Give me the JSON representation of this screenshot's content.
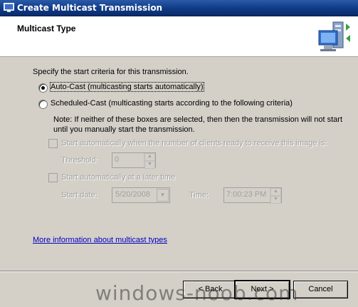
{
  "window": {
    "title": "Create Multicast Transmission"
  },
  "header": {
    "title": "Multicast Type",
    "icon": "server-computer-icon"
  },
  "intro": "Specify the start criteria for this transmission.",
  "options": {
    "auto_cast": {
      "label": "Auto-Cast (multicasting starts automatically)",
      "selected": true
    },
    "scheduled_cast": {
      "label": "Scheduled-Cast (multicasting starts according to the following criteria)",
      "selected": false
    }
  },
  "note": {
    "line1": "Note: If neither of these boxes are selected, then then the transmission will not start",
    "line2": "until you manually start the transmission."
  },
  "criteria": {
    "clients": {
      "label": "Start automatically when the number of clients ready to receive this image is:",
      "checked": false
    },
    "threshold": {
      "label": "Threshold:",
      "value": "0"
    },
    "later": {
      "label": "Start automatically at a later time",
      "checked": false
    },
    "start_date": {
      "label": "Start date:",
      "value": "5/20/2008"
    },
    "time": {
      "label": "Time:",
      "value": "7:00:23 PM"
    }
  },
  "link": "More information about multicast types",
  "buttons": {
    "back": "< Back",
    "next": "Next >",
    "cancel": "Cancel"
  },
  "watermark": "windows-noob.com"
}
